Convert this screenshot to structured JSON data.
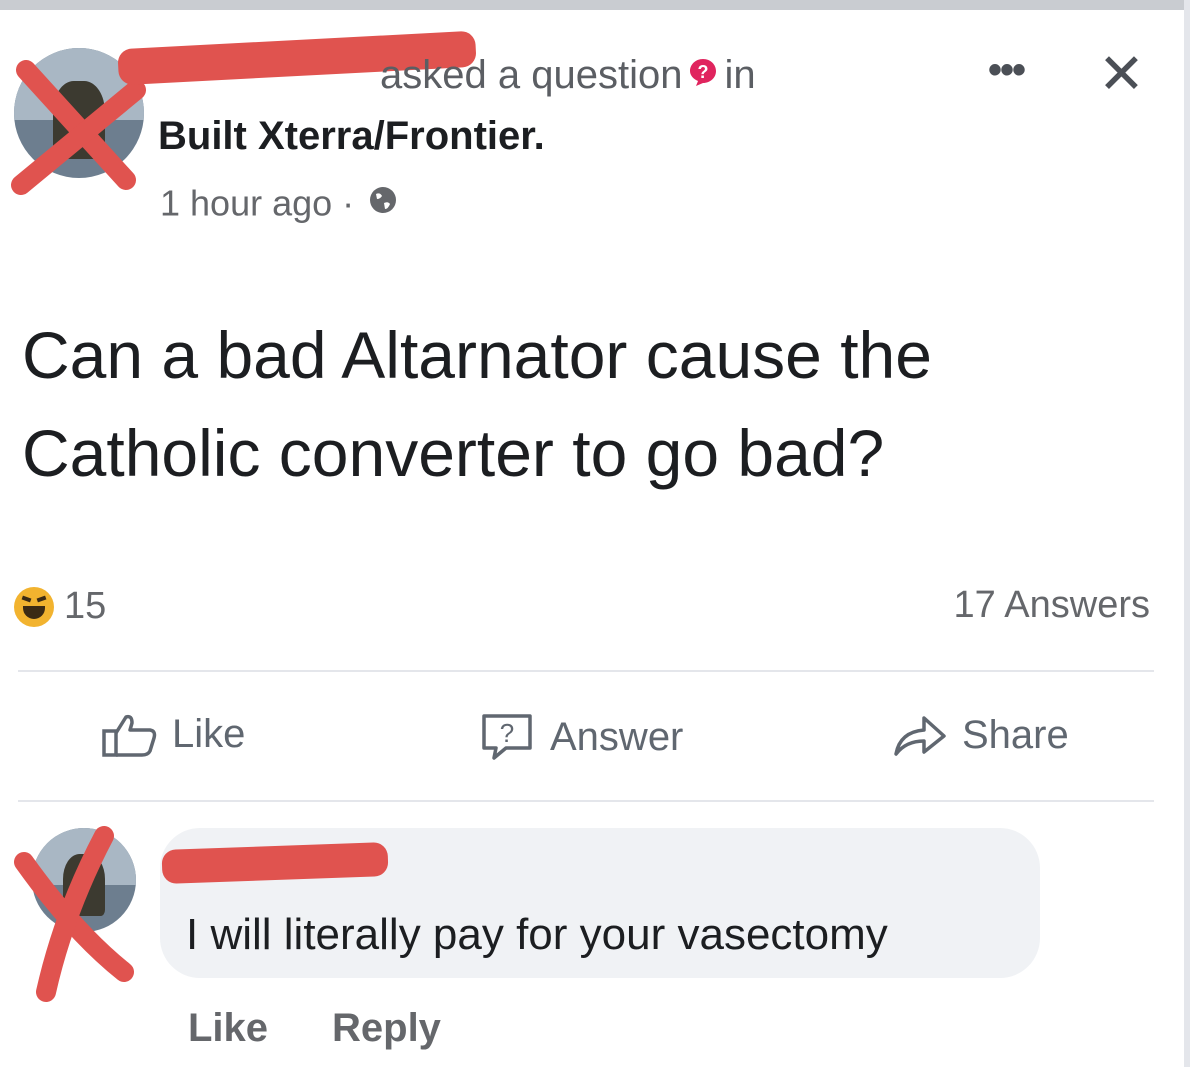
{
  "post": {
    "author_action": "asked a question",
    "in_label": "in",
    "group_name": "Built Xterra/Frontier.",
    "timestamp": "1 hour ago",
    "separator": "·",
    "more_label": "•••",
    "close_label": "✕",
    "question_text": "Can a bad Altarnator cause the Catholic converter to go bad?",
    "reaction_count": "15",
    "answers_count": "17 Answers",
    "actions": {
      "like": "Like",
      "answer": "Answer",
      "share": "Share"
    }
  },
  "comment": {
    "text": "I will literally pay for your vasectomy",
    "like": "Like",
    "reply": "Reply"
  },
  "icons": {
    "question_badge": "question-badge-icon",
    "globe": "globe-icon",
    "haha_reaction": "haha-reaction-icon",
    "like": "thumbs-up-icon",
    "answer": "question-bubble-icon",
    "share": "share-arrow-icon"
  },
  "colors": {
    "redaction": "#e0534f",
    "text_primary": "#1c1e21",
    "text_secondary": "#65676b",
    "comment_bubble": "#f0f2f5",
    "question_badge": "#e0245e"
  }
}
